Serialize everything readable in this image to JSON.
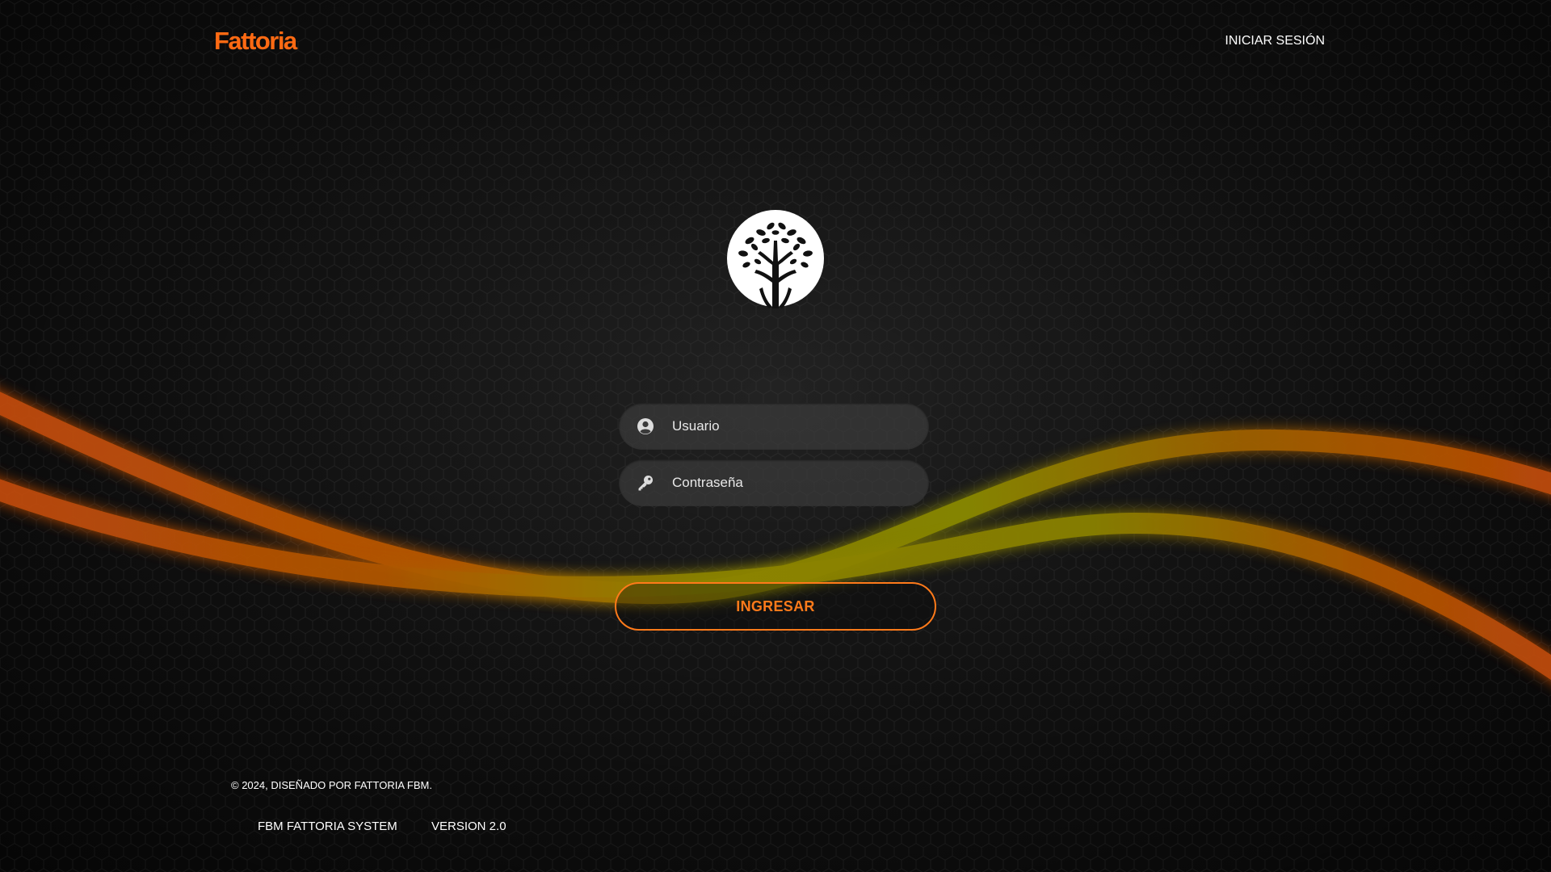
{
  "header": {
    "brand": "Fattoria",
    "login_link": "INICIAR SESIÓN"
  },
  "form": {
    "username_placeholder": "Usuario",
    "password_placeholder": "Contraseña",
    "submit_label": "INGRESAR"
  },
  "footer": {
    "copyright": "© 2024, DISEÑADO POR FATTORIA FBM.",
    "links": [
      "FBM FATTORIA SYSTEM",
      "VERSION 2.0"
    ]
  },
  "icons": {
    "logo": "tree-logo-icon",
    "username": "user-circle-icon",
    "password": "key-icon"
  },
  "colors": {
    "accent": "#ff7a1a",
    "background": "#151515",
    "wave_orange": "#c8520a",
    "wave_olive": "#8a8a00"
  }
}
